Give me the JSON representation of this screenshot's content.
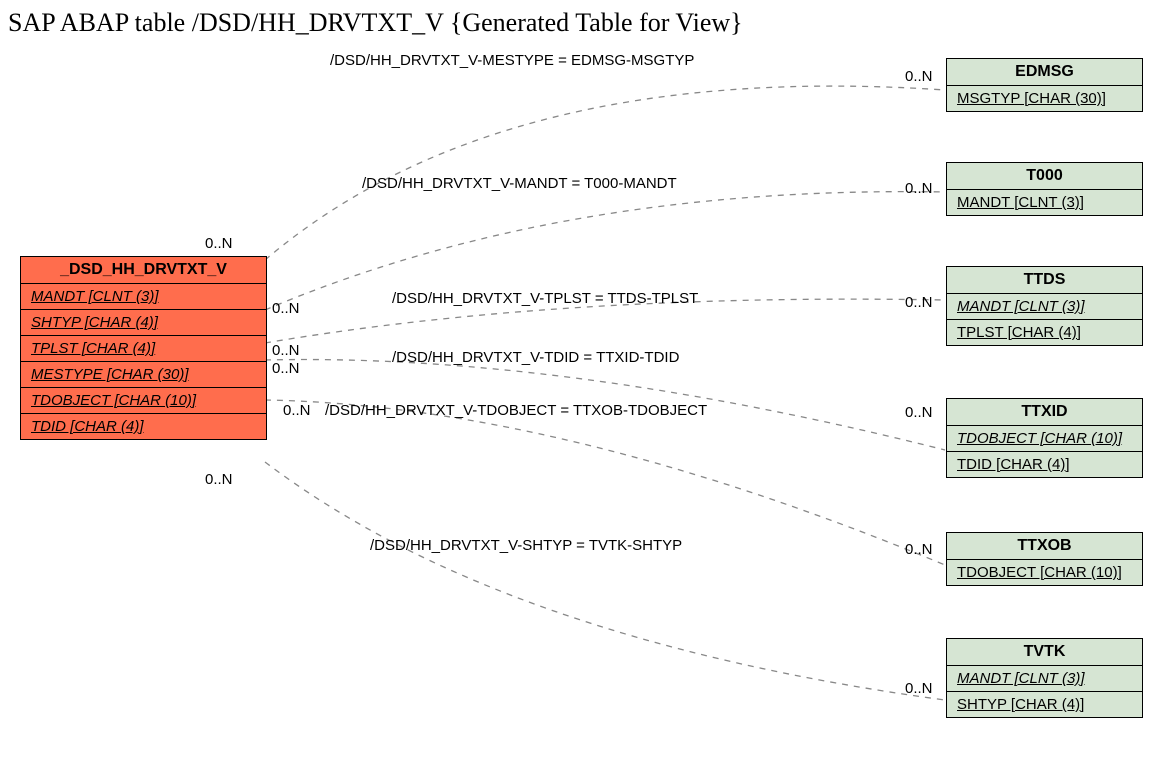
{
  "title": "SAP ABAP table /DSD/HH_DRVTXT_V {Generated Table for View}",
  "main": {
    "name": "_DSD_HH_DRVTXT_V",
    "rows": [
      "MANDT [CLNT (3)]",
      "SHTYP [CHAR (4)]",
      "TPLST [CHAR (4)]",
      "MESTYPE [CHAR (30)]",
      "TDOBJECT [CHAR (10)]",
      "TDID [CHAR (4)]"
    ]
  },
  "targets": {
    "edmsg": {
      "name": "EDMSG",
      "rows": [
        "MSGTYP [CHAR (30)]"
      ]
    },
    "t000": {
      "name": "T000",
      "rows": [
        "MANDT [CLNT (3)]"
      ]
    },
    "ttds": {
      "name": "TTDS",
      "rows": [
        "MANDT [CLNT (3)]",
        "TPLST [CHAR (4)]"
      ]
    },
    "ttxid": {
      "name": "TTXID",
      "rows": [
        "TDOBJECT [CHAR (10)]",
        "TDID [CHAR (4)]"
      ]
    },
    "ttxob": {
      "name": "TTXOB",
      "rows": [
        "TDOBJECT [CHAR (10)]"
      ]
    },
    "tvtk": {
      "name": "TVTK",
      "rows": [
        "MANDT [CLNT (3)]",
        "SHTYP [CHAR (4)]"
      ]
    }
  },
  "edges": {
    "e1": "/DSD/HH_DRVTXT_V-MESTYPE = EDMSG-MSGTYP",
    "e2": "/DSD/HH_DRVTXT_V-MANDT = T000-MANDT",
    "e3": "/DSD/HH_DRVTXT_V-TPLST = TTDS-TPLST",
    "e4": "/DSD/HH_DRVTXT_V-TDID = TTXID-TDID",
    "e5": "/DSD/HH_DRVTXT_V-TDOBJECT = TTXOB-TDOBJECT",
    "e6": "/DSD/HH_DRVTXT_V-SHTYP = TVTK-SHTYP"
  },
  "card": {
    "left1": "0..N",
    "left2": "0..N",
    "left3": "0..N",
    "left4": "0..N",
    "left5": "0..N",
    "left6": "0..N",
    "r1": "0..N",
    "r2": "0..N",
    "r3": "0..N",
    "r4": "0..N",
    "r5": "0..N",
    "r6": "0..N"
  }
}
